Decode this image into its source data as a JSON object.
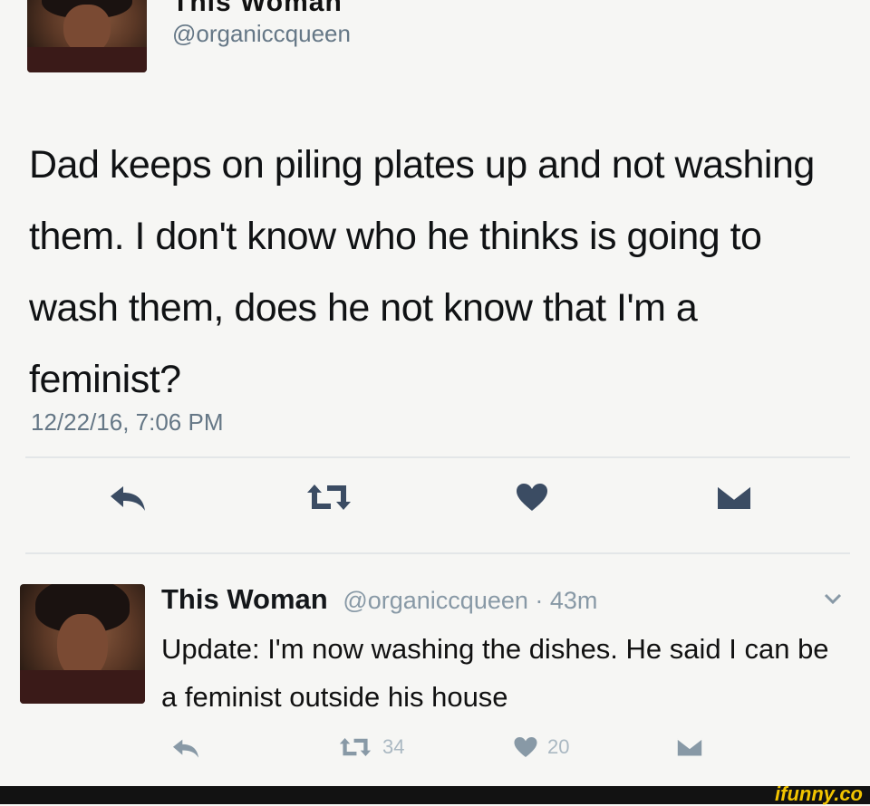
{
  "tweet": {
    "display_name_partial": "This Woman",
    "handle": "@organiccqueen",
    "text": "Dad keeps on piling plates up and not washing them. I don't  know who he thinks is going to wash them, does he not know that I'm a feminist?",
    "timestamp": "12/22/16, 7:06 PM",
    "actions": {
      "reply_icon": "reply-arrow-icon",
      "retweet_icon": "retweet-icon",
      "like_icon": "heart-icon",
      "dm_icon": "envelope-icon"
    }
  },
  "reply": {
    "display_name": "This Woman",
    "meta": "@organiccqueen · 43m",
    "text": "Update: I'm now washing the dishes. He said I can be a feminist outside his house",
    "retweet_count": "34",
    "like_count": "20"
  },
  "watermark": "ifunny.co",
  "colors": {
    "background": "#f6f6f4",
    "text": "#14171a",
    "muted": "#657786",
    "icon_active": "#3b4c63",
    "icon_muted": "#aab8c2",
    "watermark": "#f2c400"
  }
}
